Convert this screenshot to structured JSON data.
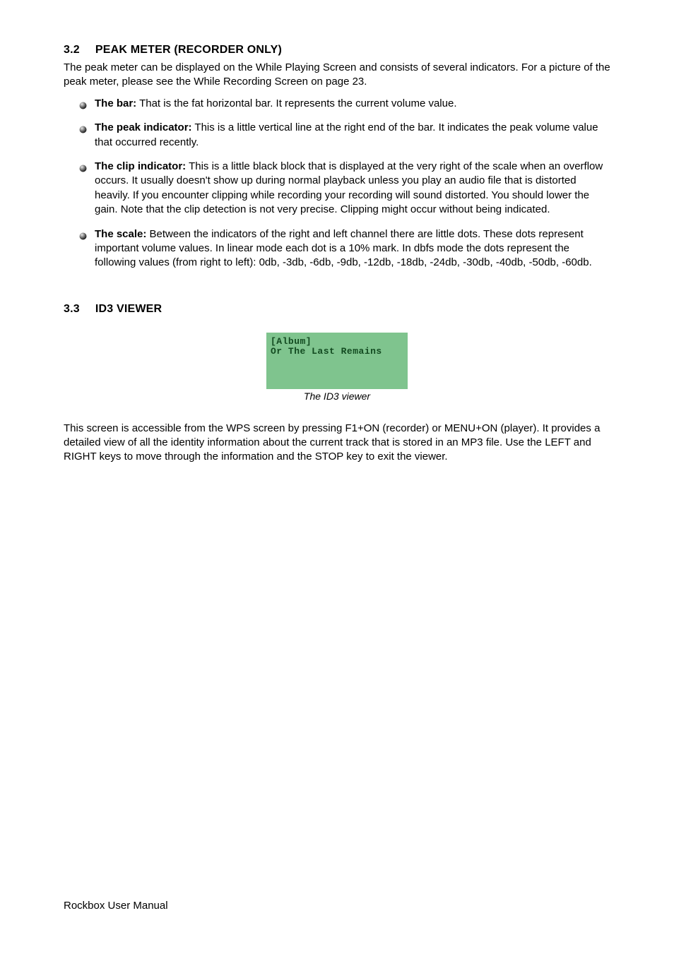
{
  "section32": {
    "num": "3.2",
    "title": "PEAK METER (RECORDER ONLY)",
    "intro": "The peak meter can be displayed on the While Playing Screen and consists of several indicators.  For a picture of the peak meter, please see the While Recording Screen on page 23.",
    "items": [
      {
        "label": "The bar:",
        "text": " That is the fat horizontal bar. It represents the current volume value."
      },
      {
        "label": "The peak indicator:",
        "text": " This is a little vertical line at the right end of the bar. It indicates the peak volume value that occurred recently."
      },
      {
        "label": "The clip indicator:",
        "text": " This is a little black block that is displayed at the very right of the scale when an overflow occurs. It usually doesn't show up during normal playback unless you play an audio file that is distorted heavily. If you encounter clipping while recording your recording will sound distorted. You should lower the gain. Note that the clip detection is not very precise. Clipping might occur without being indicated."
      },
      {
        "label": "The scale:",
        "text": " Between the indicators of the right and left channel there are little dots. These dots represent important volume values. In linear mode each dot is a 10% mark. In dbfs mode the dots represent the following values (from right to left): 0db, -3db, -6db, -9db, -12db, -18db, -24db, -30db, -40db, -50db, -60db."
      }
    ]
  },
  "section33": {
    "num": "3.3",
    "title": "ID3 VIEWER",
    "lcd_line1": "[Album]",
    "lcd_line2": "Or The Last Remains",
    "caption": "The ID3 viewer",
    "body": "This screen is accessible from the WPS screen by pressing F1+ON (recorder) or MENU+ON (player).  It provides a detailed view of all the identity information about the current track that is stored in an MP3 file.  Use the LEFT and RIGHT keys to move through the information and the STOP key to exit the viewer."
  },
  "footer": "Rockbox User Manual"
}
